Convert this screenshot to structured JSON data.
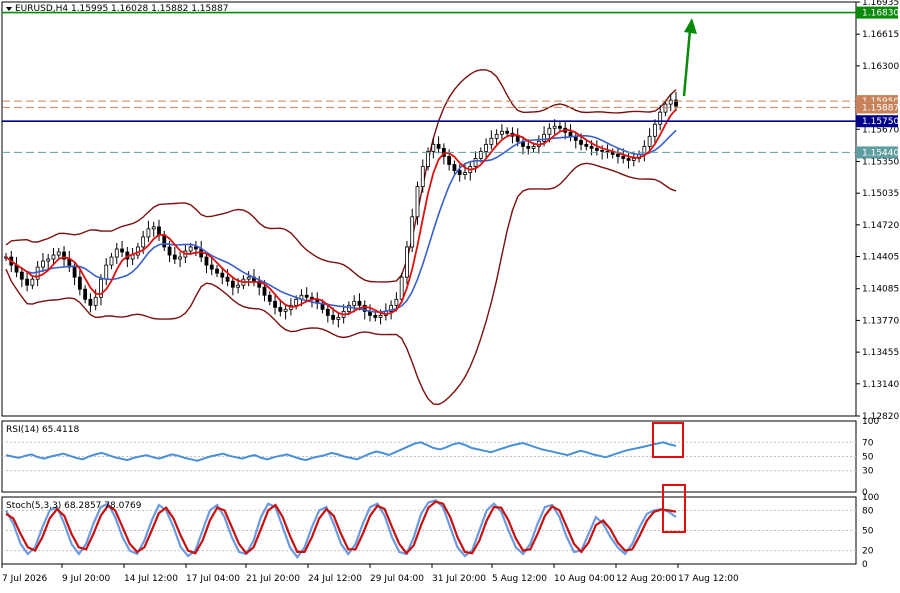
{
  "chart_data": {
    "type": "candlestick",
    "header": {
      "symbol": "EURUSD,H4",
      "ohlc": "1.15995 1.16028 1.15882 1.15887"
    },
    "price_ticks": [
      "1.16935",
      "1.16615",
      "1.16300",
      "1.15670",
      "1.15350",
      "1.15035",
      "1.14720",
      "1.14405",
      "1.14085",
      "1.13770",
      "1.13455",
      "1.13140",
      "1.12820"
    ],
    "price_range": [
      1.1282,
      1.16935
    ],
    "levels": [
      {
        "label": "1.16830",
        "value": 1.1683,
        "color": "#0a8a0a",
        "style": "solid"
      },
      {
        "label": "1.15950",
        "value": 1.1595,
        "color": "#c8825a",
        "style": "dashed"
      },
      {
        "label": "1.15887",
        "value": 1.15887,
        "color": "#c8825a",
        "style": "dashed"
      },
      {
        "label": "1.15750",
        "value": 1.1575,
        "color": "#00008b",
        "style": "solid"
      },
      {
        "label": "1.15440",
        "value": 1.1544,
        "color": "#5f9ea0",
        "style": "dashed"
      }
    ],
    "x_labels": [
      "7 Jul 2026",
      "9 Jul 20:00",
      "14 Jul 12:00",
      "17 Jul 04:00",
      "21 Jul 20:00",
      "24 Jul 12:00",
      "29 Jul 04:00",
      "31 Jul 20:00",
      "5 Aug 12:00",
      "10 Aug 04:00",
      "12 Aug 20:00",
      "17 Aug 12:00"
    ],
    "close_series": [
      1.144,
      1.1432,
      1.1425,
      1.1418,
      1.1412,
      1.1418,
      1.143,
      1.1436,
      1.1438,
      1.1442,
      1.1445,
      1.1438,
      1.143,
      1.142,
      1.1408,
      1.1398,
      1.1392,
      1.14,
      1.1418,
      1.1432,
      1.144,
      1.1448,
      1.1445,
      1.1438,
      1.1442,
      1.145,
      1.146,
      1.1468,
      1.147,
      1.1462,
      1.145,
      1.1442,
      1.1438,
      1.144,
      1.1446,
      1.145,
      1.1448,
      1.144,
      1.1432,
      1.1428,
      1.1424,
      1.142,
      1.1416,
      1.141,
      1.1412,
      1.1418,
      1.142,
      1.1416,
      1.141,
      1.1402,
      1.1396,
      1.139,
      1.1386,
      1.1388,
      1.1392,
      1.1398,
      1.1402,
      1.14,
      1.1398,
      1.1394,
      1.1388,
      1.1382,
      1.1378,
      1.138,
      1.1386,
      1.1392,
      1.1396,
      1.1392,
      1.1386,
      1.1382,
      1.138,
      1.1382,
      1.1386,
      1.1392,
      1.1398,
      1.142,
      1.145,
      1.148,
      1.151,
      1.153,
      1.1545,
      1.1552,
      1.1548,
      1.154,
      1.1532,
      1.1526,
      1.1522,
      1.1524,
      1.153,
      1.1538,
      1.1545,
      1.1552,
      1.1558,
      1.1562,
      1.1565,
      1.1563,
      1.156,
      1.1555,
      1.155,
      1.1548,
      1.155,
      1.1555,
      1.1562,
      1.1568,
      1.157,
      1.1568,
      1.1564,
      1.156,
      1.1556,
      1.1552,
      1.155,
      1.1548,
      1.1546,
      1.1545,
      1.1544,
      1.1542,
      1.154,
      1.1538,
      1.1536,
      1.1538,
      1.1542,
      1.155,
      1.156,
      1.1572,
      1.1584,
      1.1592,
      1.1596,
      1.159
    ],
    "rsi": {
      "label": "RSI(14) 65.4118",
      "value": 65.4118,
      "levels": [
        70,
        50,
        30
      ],
      "ticks": [
        "100",
        "70",
        "50",
        "30",
        "0"
      ],
      "series": [
        52,
        50,
        48,
        51,
        53,
        49,
        47,
        50,
        52,
        54,
        51,
        48,
        46,
        50,
        53,
        55,
        52,
        49,
        47,
        45,
        48,
        50,
        52,
        49,
        47,
        50,
        53,
        51,
        48,
        46,
        44,
        47,
        50,
        52,
        54,
        51,
        49,
        47,
        50,
        52,
        48,
        46,
        49,
        51,
        53,
        50,
        47,
        45,
        48,
        50,
        52,
        55,
        53,
        50,
        48,
        46,
        50,
        54,
        57,
        55,
        52,
        56,
        60,
        64,
        68,
        70,
        66,
        62,
        60,
        63,
        67,
        69,
        66,
        62,
        60,
        58,
        56,
        59,
        62,
        65,
        67,
        69,
        66,
        63,
        60,
        58,
        56,
        54,
        52,
        55,
        58,
        56,
        53,
        51,
        49,
        52,
        55,
        58,
        60,
        62,
        64,
        66,
        68,
        70,
        67,
        65
      ]
    },
    "stoch": {
      "label": "Stoch(5,3,3) 68.2857 78.0769",
      "k": 68.2857,
      "d": 78.0769,
      "levels": [
        80,
        50,
        20
      ],
      "ticks": [
        "100",
        "80",
        "50",
        "20",
        "0"
      ],
      "k_series": [
        80,
        60,
        30,
        15,
        25,
        55,
        80,
        85,
        60,
        30,
        15,
        30,
        60,
        85,
        90,
        70,
        40,
        20,
        15,
        35,
        65,
        88,
        80,
        55,
        25,
        12,
        20,
        50,
        80,
        88,
        70,
        40,
        18,
        15,
        35,
        70,
        90,
        85,
        55,
        25,
        10,
        25,
        55,
        80,
        85,
        60,
        30,
        15,
        30,
        60,
        85,
        90,
        72,
        40,
        18,
        15,
        40,
        75,
        92,
        95,
        85,
        55,
        25,
        12,
        20,
        50,
        80,
        90,
        78,
        50,
        25,
        15,
        30,
        60,
        85,
        88,
        70,
        40,
        18,
        20,
        45,
        70,
        60,
        40,
        25,
        15,
        30,
        55,
        75,
        80,
        82,
        78,
        70
      ],
      "d_series": [
        75,
        68,
        45,
        25,
        20,
        40,
        68,
        82,
        72,
        45,
        25,
        22,
        45,
        72,
        87,
        80,
        55,
        30,
        18,
        25,
        50,
        76,
        84,
        68,
        42,
        20,
        16,
        35,
        65,
        84,
        80,
        55,
        30,
        16,
        25,
        52,
        80,
        88,
        70,
        42,
        18,
        18,
        40,
        68,
        82,
        72,
        45,
        22,
        22,
        45,
        72,
        87,
        82,
        55,
        30,
        16,
        28,
        58,
        84,
        93,
        90,
        70,
        40,
        18,
        16,
        35,
        65,
        85,
        84,
        65,
        38,
        20,
        22,
        45,
        72,
        86,
        80,
        55,
        30,
        18,
        32,
        58,
        65,
        52,
        32,
        20,
        22,
        42,
        65,
        78,
        81,
        80,
        78
      ]
    }
  }
}
